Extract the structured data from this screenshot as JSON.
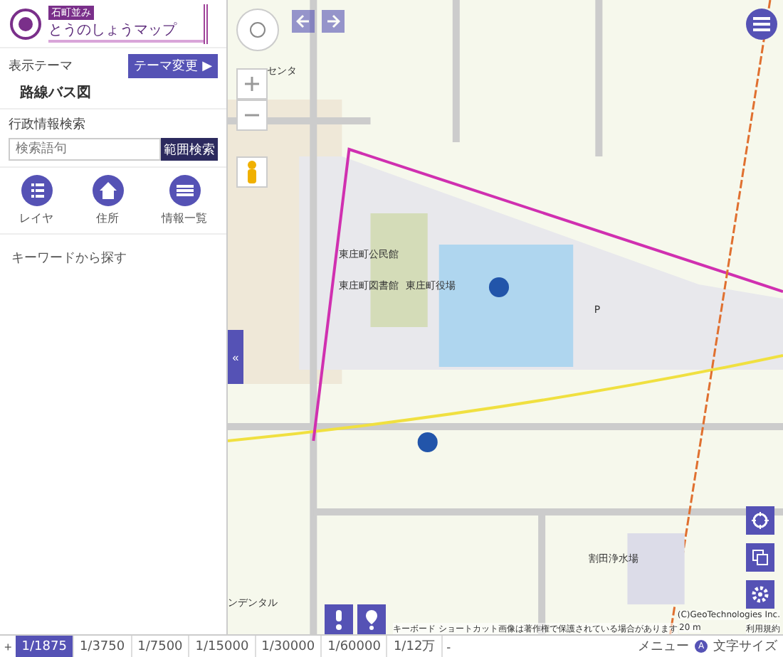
{
  "header": {
    "logo_badge": "石町並み",
    "logo_title": "とうのしょうマップ"
  },
  "theme": {
    "label": "表示テーマ",
    "name": "路線バス図",
    "change_button": "テーマ変更 ▶"
  },
  "search": {
    "label": "行政情報検索",
    "placeholder": "検索語句",
    "button": "範囲検索"
  },
  "tools": [
    {
      "kind": "list",
      "label": "レイヤ"
    },
    {
      "kind": "house",
      "label": "住所"
    },
    {
      "kind": "table",
      "label": "情報一覧"
    }
  ],
  "keyword": "キーワードから探す",
  "map": {
    "labels": [
      "センタ",
      "東庄町公民館",
      "東庄町図書館",
      "東庄町役場",
      "P",
      "割田浄水場",
      "ンデンタル"
    ],
    "collapse": "«",
    "keyboard": "キーボード ショートカット",
    "notice": "画像は著作権で保護されている場合があります",
    "scale": "20 m",
    "terms": "利用規約",
    "copyright": "(C)GeoTechnologies Inc."
  },
  "scalebar": {
    "zoom_in": "+",
    "zoom_out": "-",
    "scales": [
      {
        "label": "1/1875",
        "selected": true
      },
      {
        "label": "1/3750",
        "selected": false
      },
      {
        "label": "1/7500",
        "selected": false
      },
      {
        "label": "1/15000",
        "selected": false
      },
      {
        "label": "1/30000",
        "selected": false
      },
      {
        "label": "1/60000",
        "selected": false
      },
      {
        "label": "1/12万",
        "selected": false
      }
    ],
    "menu": "メニュー",
    "text_size": "文字サイズ",
    "text_size_icon": "A"
  }
}
